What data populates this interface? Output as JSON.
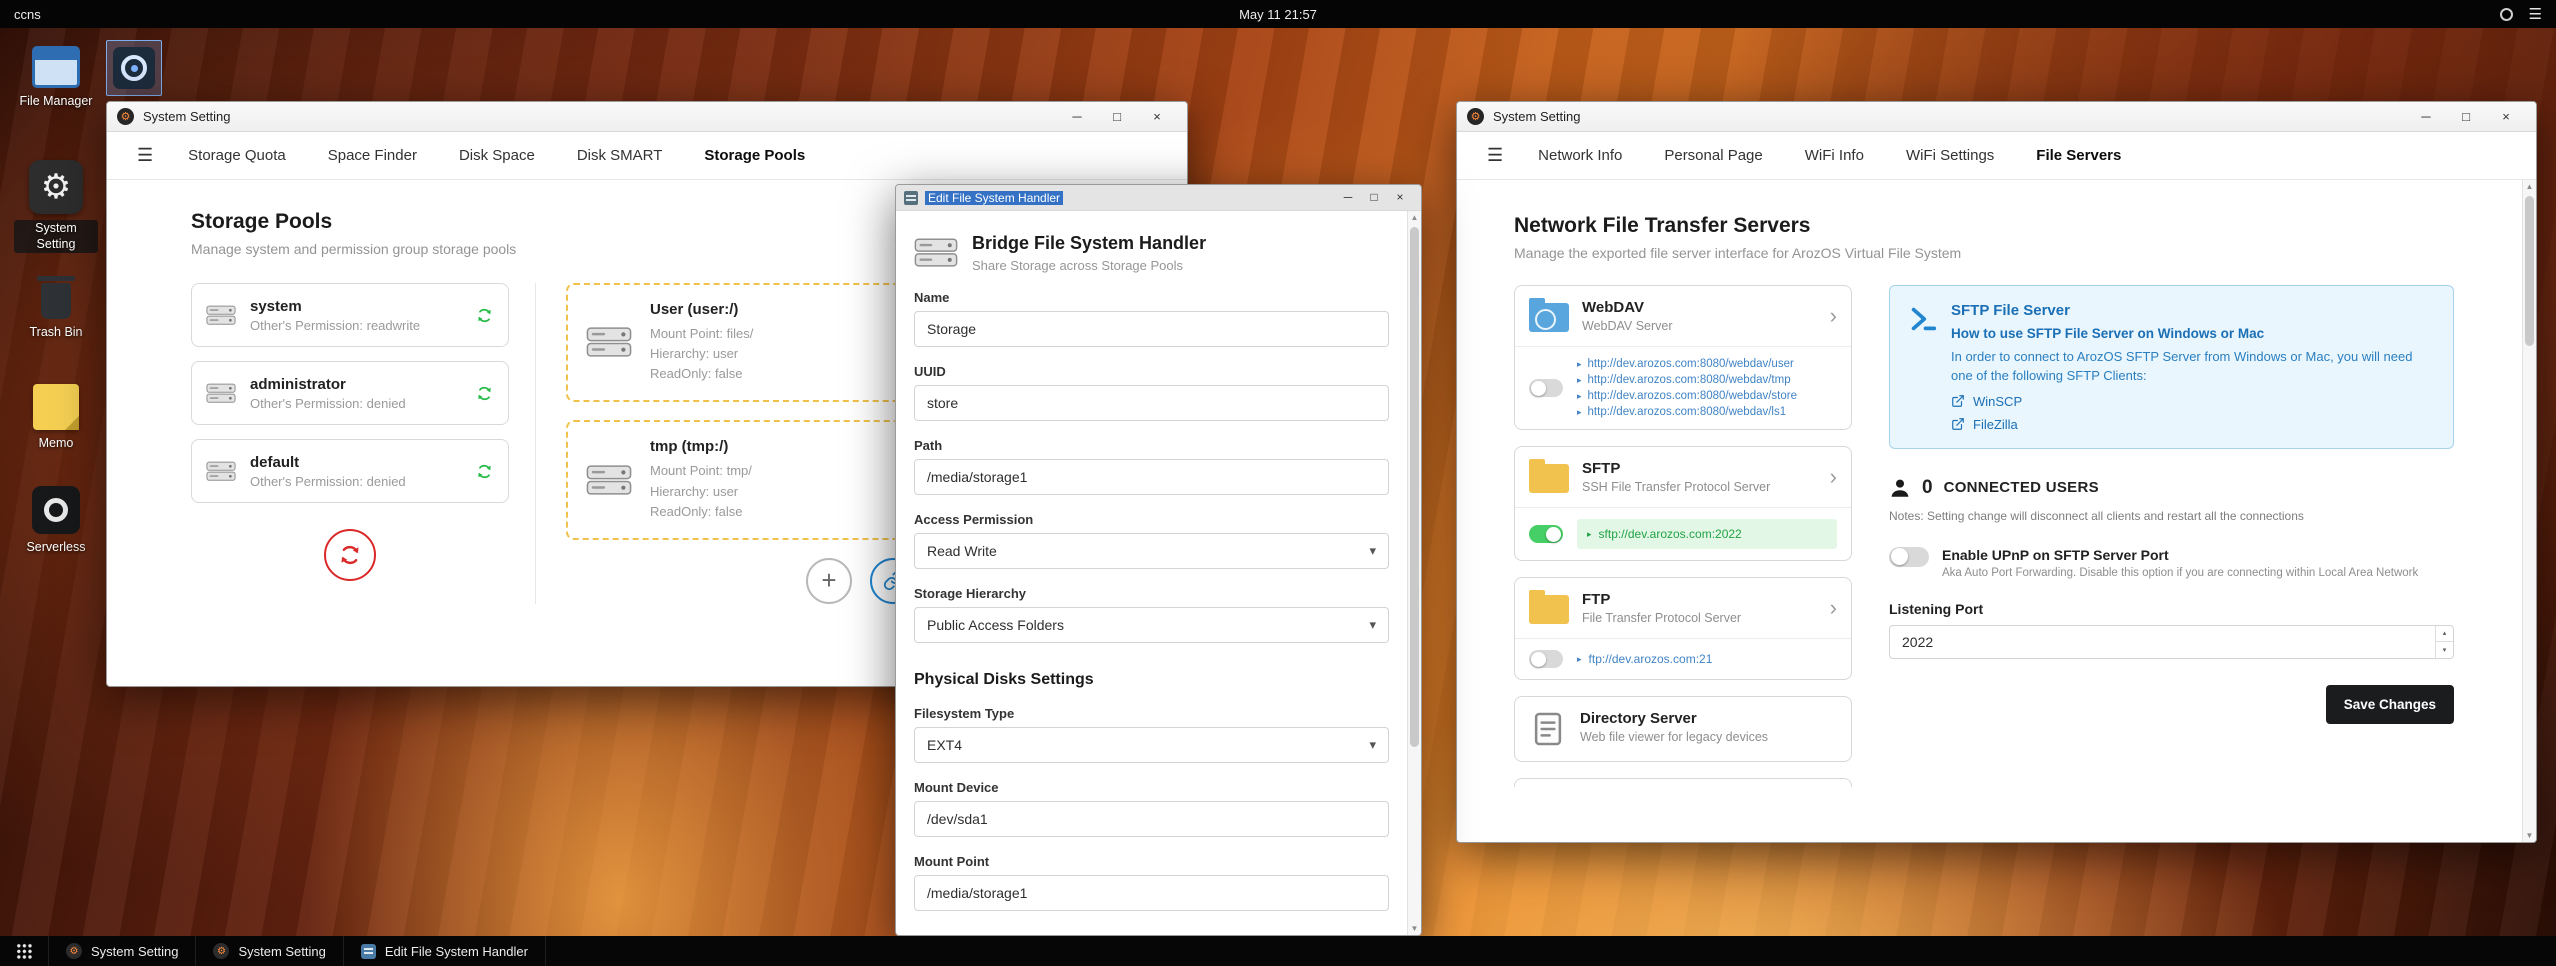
{
  "icons": {
    "gear": "⚙",
    "hamburger": "☰",
    "minimize": "─",
    "maximize": "□",
    "close": "×",
    "chevron_right": "›",
    "caret_down": "▾",
    "bullet": "▸",
    "scroll_up": "▲",
    "scroll_down": "▼",
    "spin_up": "▴",
    "spin_down": "▾",
    "plus": "+"
  },
  "colors": {
    "green": "#21ba45",
    "blue": "#2185d0",
    "link_blue": "#4183c4",
    "red": "#db2828",
    "dashed_yellow": "#f0c24b",
    "dark_button": "#1b1c1d",
    "info_bg": "#e9f6fd"
  },
  "topbar": {
    "host": "ccns",
    "clock": "May 11 21:57"
  },
  "desktop": {
    "icons": {
      "file_manager": "File Manager",
      "system_setting": "System Setting",
      "trash_bin": "Trash Bin",
      "memo": "Memo",
      "serverless": "Serverless"
    }
  },
  "win1": {
    "title": "System Setting",
    "tabs": [
      "Storage Quota",
      "Space Finder",
      "Disk Space",
      "Disk SMART",
      "Storage Pools"
    ],
    "active_tab": "Storage Pools",
    "heading": "Storage Pools",
    "subheading": "Manage system and permission group storage pools",
    "pools": [
      {
        "name": "system",
        "permission": "Other's Permission: readwrite"
      },
      {
        "name": "administrator",
        "permission": "Other's Permission: denied"
      },
      {
        "name": "default",
        "permission": "Other's Permission: denied"
      }
    ],
    "mounts": [
      {
        "name": "User (user:/)",
        "mount_point": "Mount Point: files/",
        "hierarchy": "Hierarchy: user",
        "readonly": "ReadOnly: false"
      },
      {
        "name": "tmp (tmp:/)",
        "mount_point": "Mount Point: tmp/",
        "hierarchy": "Hierarchy: user",
        "readonly": "ReadOnly: false"
      }
    ]
  },
  "win2": {
    "title": "Edit File System Handler",
    "heading": "Bridge File System Handler",
    "subheading": "Share Storage across Storage Pools",
    "fields": {
      "name_label": "Name",
      "name_value": "Storage",
      "uuid_label": "UUID",
      "uuid_value": "store",
      "path_label": "Path",
      "path_value": "/media/storage1",
      "access_label": "Access Permission",
      "access_value": "Read Write",
      "hierarchy_label": "Storage Hierarchy",
      "hierarchy_value": "Public Access Folders",
      "section": "Physical Disks Settings",
      "fstype_label": "Filesystem Type",
      "fstype_value": "EXT4",
      "mount_device_label": "Mount Device",
      "mount_device_value": "/dev/sda1",
      "mount_point_label": "Mount Point",
      "mount_point_value": "/media/storage1"
    }
  },
  "win3": {
    "title": "System Setting",
    "tabs": [
      "Network Info",
      "Personal Page",
      "WiFi Info",
      "WiFi Settings",
      "File Servers"
    ],
    "active_tab": "File Servers",
    "heading": "Network File Transfer Servers",
    "subheading": "Manage the exported file server interface for ArozOS Virtual File System",
    "webdav": {
      "name": "WebDAV",
      "desc": "WebDAV Server",
      "links": [
        "http://dev.arozos.com:8080/webdav/user",
        "http://dev.arozos.com:8080/webdav/tmp",
        "http://dev.arozos.com:8080/webdav/store",
        "http://dev.arozos.com:8080/webdav/ls1"
      ]
    },
    "sftp": {
      "name": "SFTP",
      "desc": "SSH File Transfer Protocol Server",
      "link": "sftp://dev.arozos.com:2022"
    },
    "ftp": {
      "name": "FTP",
      "desc": "File Transfer Protocol Server",
      "link": "ftp://dev.arozos.com:21"
    },
    "dirserver": {
      "name": "Directory Server",
      "desc": "Web file viewer for legacy devices"
    },
    "info": {
      "title": "SFTP File Server",
      "subtitle": "How to use SFTP File Server on Windows or Mac",
      "body": "In order to connect to ArozOS SFTP Server from Windows or Mac, you will need one of the following SFTP Clients:",
      "clients": [
        "WinSCP",
        "FileZilla"
      ]
    },
    "connected": {
      "count": "0",
      "label": "CONNECTED USERS",
      "notes": "Notes: Setting change will disconnect all clients and restart all the connections"
    },
    "upnp": {
      "label": "Enable UPnP on SFTP Server Port",
      "desc": "Aka Auto Port Forwarding. Disable this option if you are connecting within Local Area Network"
    },
    "port": {
      "label": "Listening Port",
      "value": "2022"
    },
    "save_label": "Save Changes"
  },
  "taskbar": {
    "items": [
      "System Setting",
      "System Setting",
      "Edit File System Handler"
    ]
  }
}
